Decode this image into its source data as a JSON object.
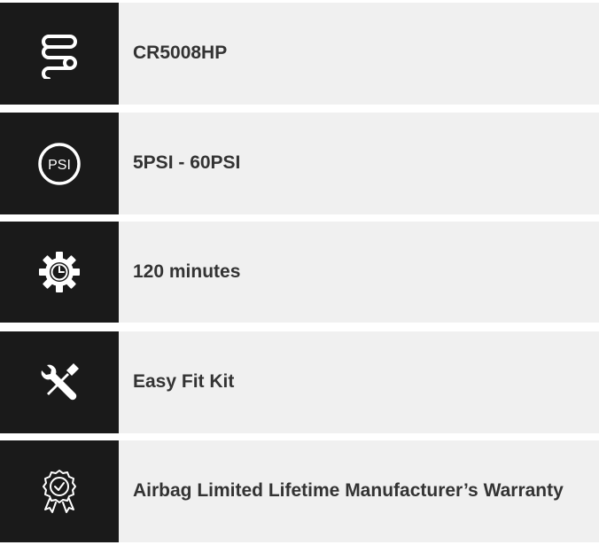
{
  "features": [
    {
      "icon": "coil-spring-icon",
      "label": "CR5008HP"
    },
    {
      "icon": "psi-gauge-icon",
      "icon_text": "PSI",
      "label": "5PSI - 60PSI"
    },
    {
      "icon": "gear-clock-icon",
      "label": "120 minutes"
    },
    {
      "icon": "tools-icon",
      "label": "Easy Fit Kit"
    },
    {
      "icon": "warranty-badge-icon",
      "label": "Airbag Limited Lifetime Manufacturer’s Warranty"
    }
  ],
  "colors": {
    "icon_background": "#1a1a1a",
    "row_background": "#f0f0f0",
    "text": "#333333",
    "icon_stroke": "#ffffff"
  }
}
